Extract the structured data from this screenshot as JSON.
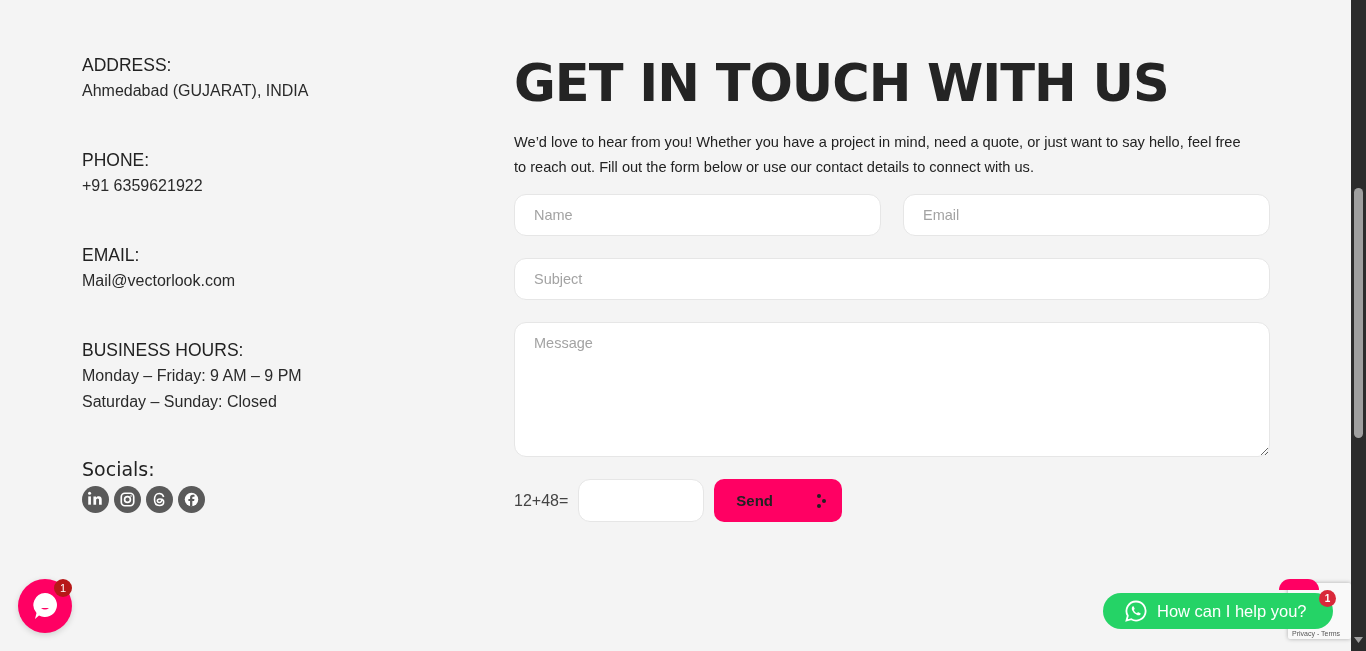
{
  "contact_info": [
    {
      "label": "ADDRESS:",
      "lines": [
        "Ahmedabad (GUJARAT), INDIA"
      ]
    },
    {
      "label": "PHONE:",
      "lines": [
        "+91 6359621922"
      ]
    },
    {
      "label": "EMAIL:",
      "lines": [
        "Mail@vectorlook.com"
      ]
    },
    {
      "label": "BUSINESS HOURS:",
      "lines": [
        "Monday – Friday: 9 AM – 9 PM",
        "Saturday – Sunday: Closed"
      ]
    }
  ],
  "socials": {
    "label": "Socials:",
    "icons": [
      {
        "kind": "linkedin"
      },
      {
        "kind": "instagram"
      },
      {
        "kind": "threads"
      },
      {
        "kind": "facebook"
      }
    ]
  },
  "heading": "GET IN TOUCH WITH US",
  "intro": "We’d love to hear from you! Whether you have a project in mind, need a quote, or just want to say hello, feel free to reach out. Fill out the form below or use our contact details to connect with us.",
  "form": {
    "name": {
      "placeholder": "Name"
    },
    "email": {
      "placeholder": "Email"
    },
    "subject": {
      "placeholder": "Subject"
    },
    "message": {
      "placeholder": "Message"
    },
    "captcha_label": "12+48=",
    "send_button": "Send"
  },
  "chat_widget": {
    "badge": "1"
  },
  "whatsapp_widget": {
    "label": "How can I help you?",
    "badge": "1"
  },
  "recaptcha": {
    "links": "Privacy - Terms"
  }
}
